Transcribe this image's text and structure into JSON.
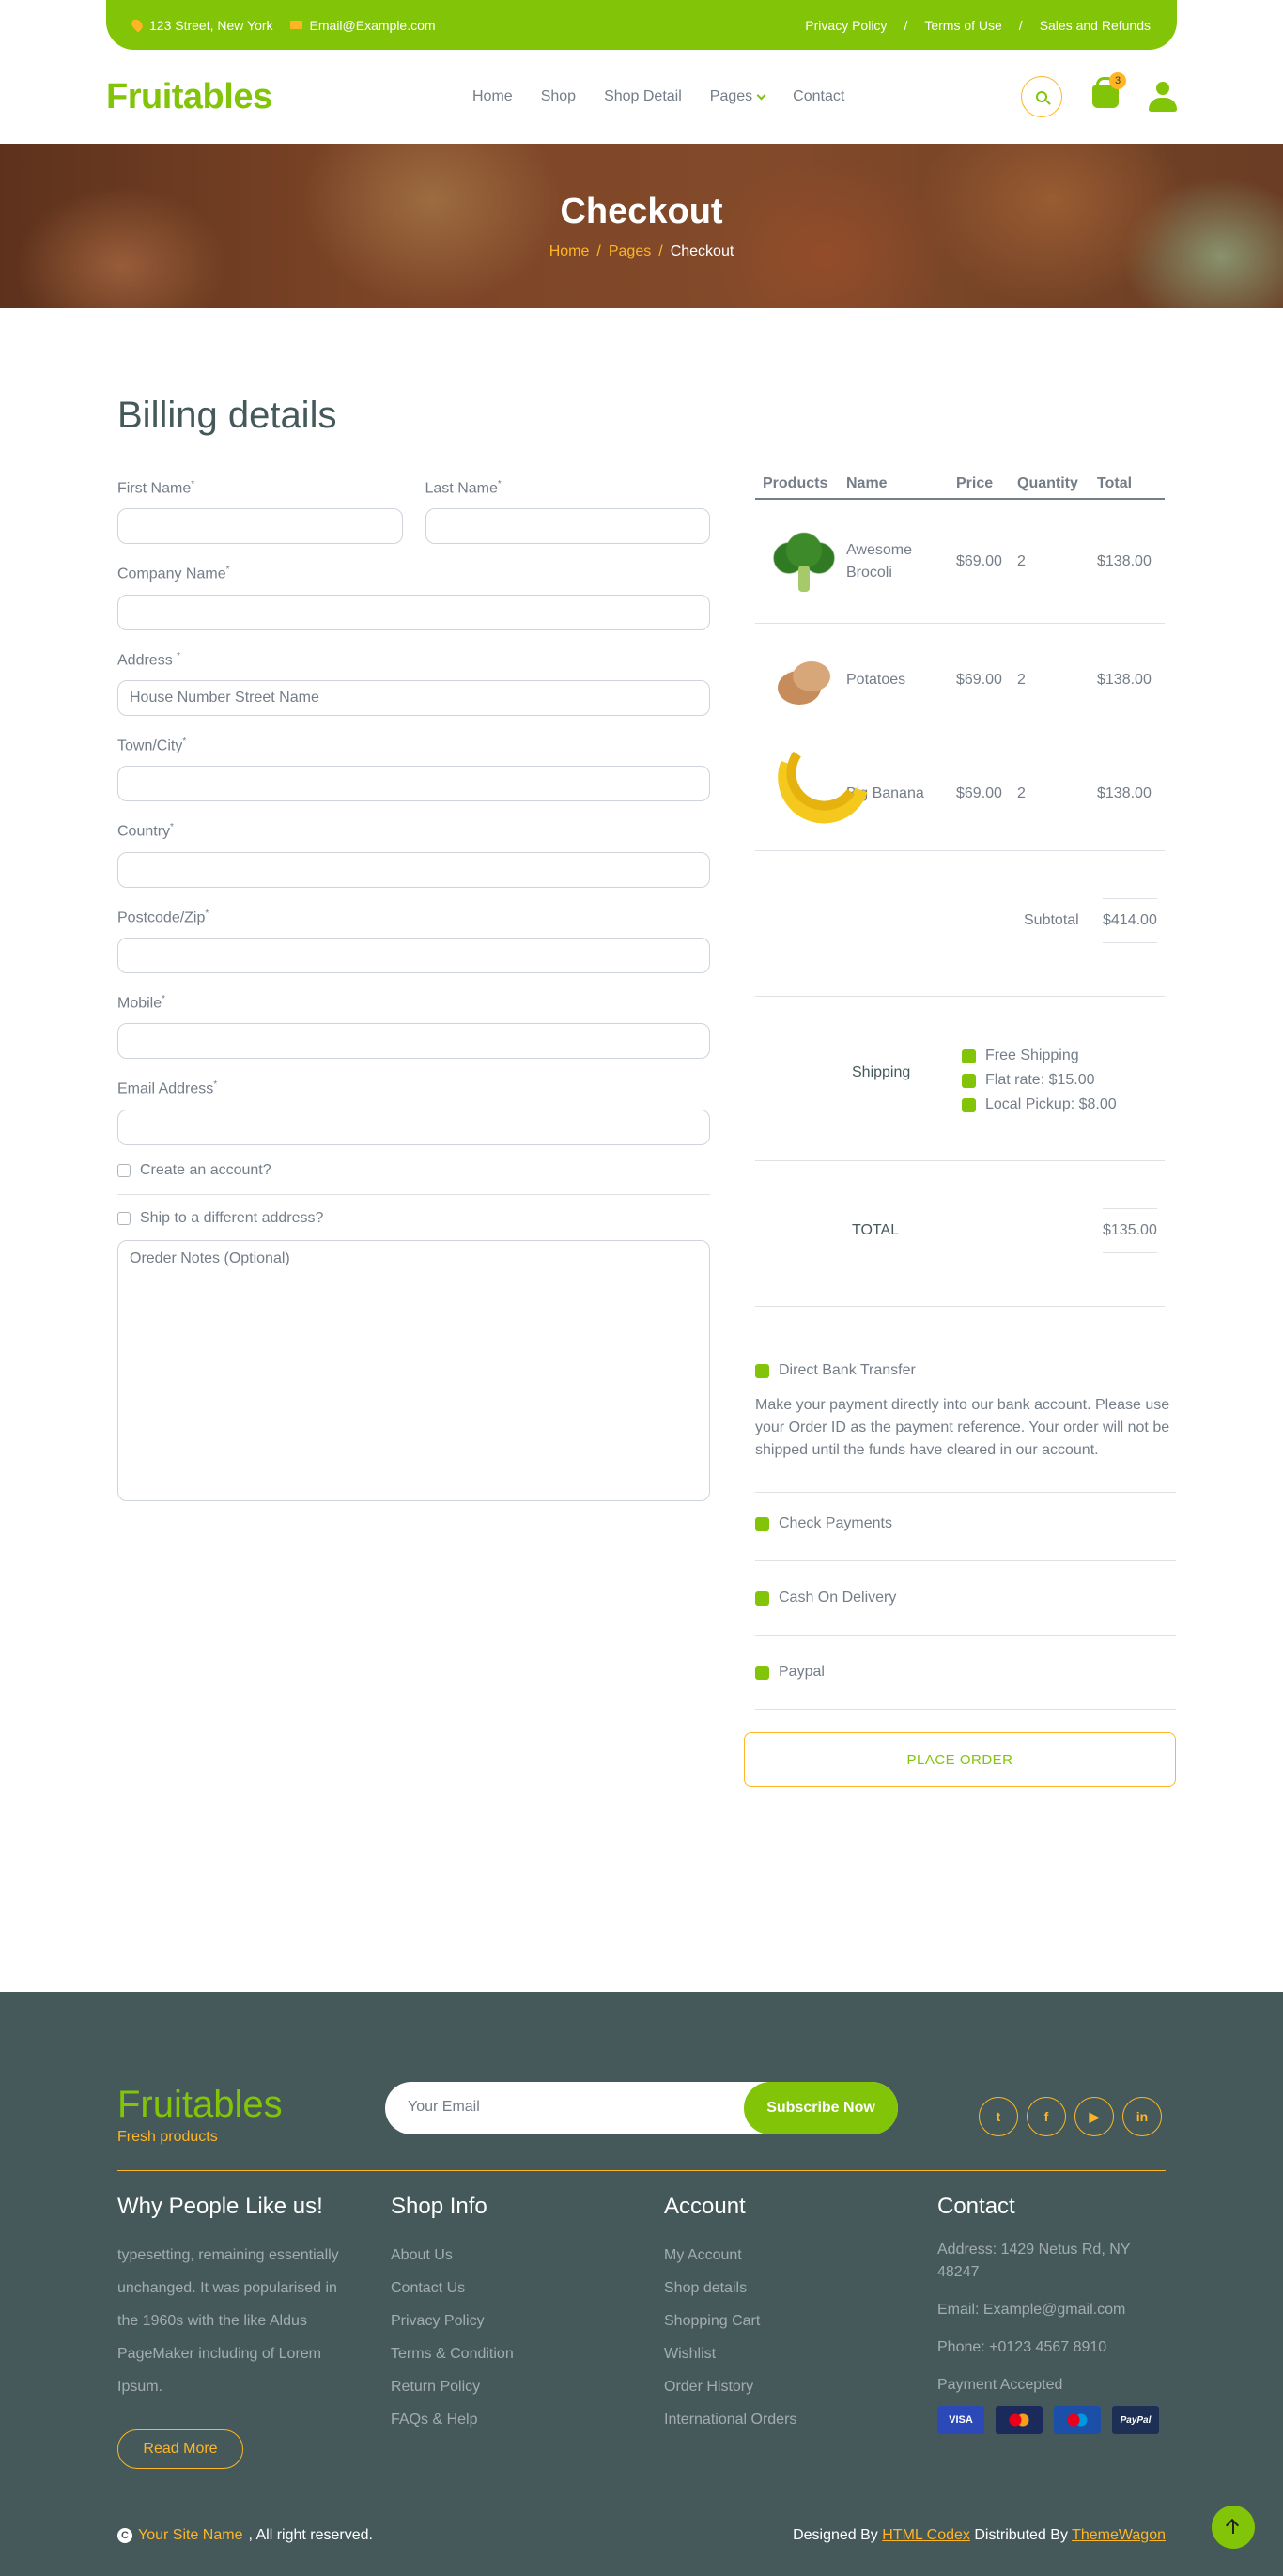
{
  "topbar": {
    "address": "123 Street, New York",
    "email": "Email@Example.com",
    "links": [
      "Privacy Policy",
      "Terms of Use",
      "Sales and Refunds"
    ],
    "separator": "/"
  },
  "nav": {
    "brand": "Fruitables",
    "items": [
      "Home",
      "Shop",
      "Shop Detail",
      "Pages",
      "Contact"
    ],
    "active": "Pages",
    "cart_count": "3"
  },
  "hero": {
    "title": "Checkout",
    "breadcrumb": [
      "Home",
      "Pages",
      "Checkout"
    ],
    "separator": "/"
  },
  "billing": {
    "title": "Billing details",
    "required_mark": "*",
    "fields": {
      "first_name": "First Name",
      "last_name": "Last Name",
      "company": "Company Name",
      "address": "Address",
      "address_placeholder": "House Number Street Name",
      "town": "Town/City",
      "country": "Country",
      "postcode": "Postcode/Zip",
      "mobile": "Mobile",
      "email": "Email Address"
    },
    "create_account": "Create an account?",
    "ship_different": "Ship to a different address?",
    "notes_placeholder": "Oreder Notes (Optional)"
  },
  "order": {
    "headers": [
      "Products",
      "Name",
      "Price",
      "Quantity",
      "Total"
    ],
    "items": [
      {
        "image": "broccoli",
        "name": "Awesome Brocoli",
        "price": "$69.00",
        "qty": "2",
        "total": "$138.00"
      },
      {
        "image": "potatoes",
        "name": "Potatoes",
        "price": "$69.00",
        "qty": "2",
        "total": "$138.00"
      },
      {
        "image": "banana",
        "name": "Big Banana",
        "price": "$69.00",
        "qty": "2",
        "total": "$138.00"
      }
    ],
    "subtotal_label": "Subtotal",
    "subtotal_value": "$414.00",
    "shipping_label": "Shipping",
    "shipping_options": [
      "Free Shipping",
      "Flat rate: $15.00",
      "Local Pickup: $8.00"
    ],
    "total_label": "TOTAL",
    "total_value": "$135.00"
  },
  "payments": {
    "bank_transfer": "Direct Bank Transfer",
    "bank_desc": "Make your payment directly into our bank account. Please use your Order ID as the payment reference. Your order will not be shipped until the funds have cleared in our account.",
    "check": "Check Payments",
    "cod": "Cash On Delivery",
    "paypal": "Paypal",
    "place_order": "PLACE ORDER"
  },
  "footer": {
    "brand": "Fruitables",
    "tagline": "Fresh products",
    "email_placeholder": "Your Email",
    "subscribe": "Subscribe Now",
    "socials": [
      "twitter-icon",
      "facebook-icon",
      "youtube-icon",
      "linkedin-icon"
    ],
    "why_title": "Why People Like us!",
    "why_text": "typesetting, remaining essentially unchanged. It was popularised in the 1960s with the like Aldus PageMaker including of Lorem Ipsum.",
    "read_more": "Read More",
    "shop_title": "Shop Info",
    "shop_links": [
      "About Us",
      "Contact Us",
      "Privacy Policy",
      "Terms & Condition",
      "Return Policy",
      "FAQs & Help"
    ],
    "account_title": "Account",
    "account_links": [
      "My Account",
      "Shop details",
      "Shopping Cart",
      "Wishlist",
      "Order History",
      "International Orders"
    ],
    "contact_title": "Contact",
    "contact_address": "Address: 1429 Netus Rd, NY 48247",
    "contact_email": "Email: Example@gmail.com",
    "contact_phone": "Phone: +0123 4567 8910",
    "payment_label": "Payment Accepted",
    "cards": [
      "VISA",
      "Mastercard",
      "Maestro",
      "PayPal"
    ]
  },
  "copyright": {
    "site": "Your Site Name",
    "rights": ", All right reserved.",
    "designed_by": "Designed By",
    "designer": "HTML Codex",
    "distributed_by": "Distributed By",
    "distributor": "ThemeWagon"
  },
  "colors": {
    "primary": "#81c408",
    "secondary": "#ffb524",
    "dark": "#45595b"
  }
}
